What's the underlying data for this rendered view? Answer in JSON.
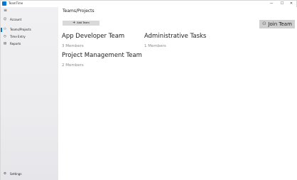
{
  "window": {
    "title": "TeamTime",
    "controls": {
      "minimize": "—",
      "maximize": "☐",
      "close": "✕"
    }
  },
  "sidebar": {
    "menu_icon": "hamburger-icon",
    "items": [
      {
        "label": "Account",
        "icon": "person-icon",
        "glyph": "☺",
        "active": false
      },
      {
        "label": "Teams/Projects",
        "icon": "people-icon",
        "glyph": "⚇",
        "active": true
      },
      {
        "label": "Time Entry",
        "icon": "clock-icon",
        "glyph": "◷",
        "active": false
      },
      {
        "label": "Reports",
        "icon": "document-icon",
        "glyph": "▤",
        "active": false
      }
    ],
    "settings": {
      "label": "Settings",
      "icon": "gear-icon",
      "glyph": "⚙"
    }
  },
  "main": {
    "page_title": "Teams/Projects",
    "add_team_label": "Add Team",
    "join_team_label": "Join Team",
    "teams": [
      {
        "name": "App Developer Team",
        "members": "3 Members"
      },
      {
        "name": "Administrative Tasks",
        "members": "1 Members"
      },
      {
        "name": "Project Management Team",
        "members": "2 Members"
      }
    ]
  },
  "colors": {
    "accent": "#0078d7",
    "sidebar_bg": "#eeeef0",
    "button_bg": "#d9d9d9",
    "muted_text": "#8a8a8a"
  }
}
